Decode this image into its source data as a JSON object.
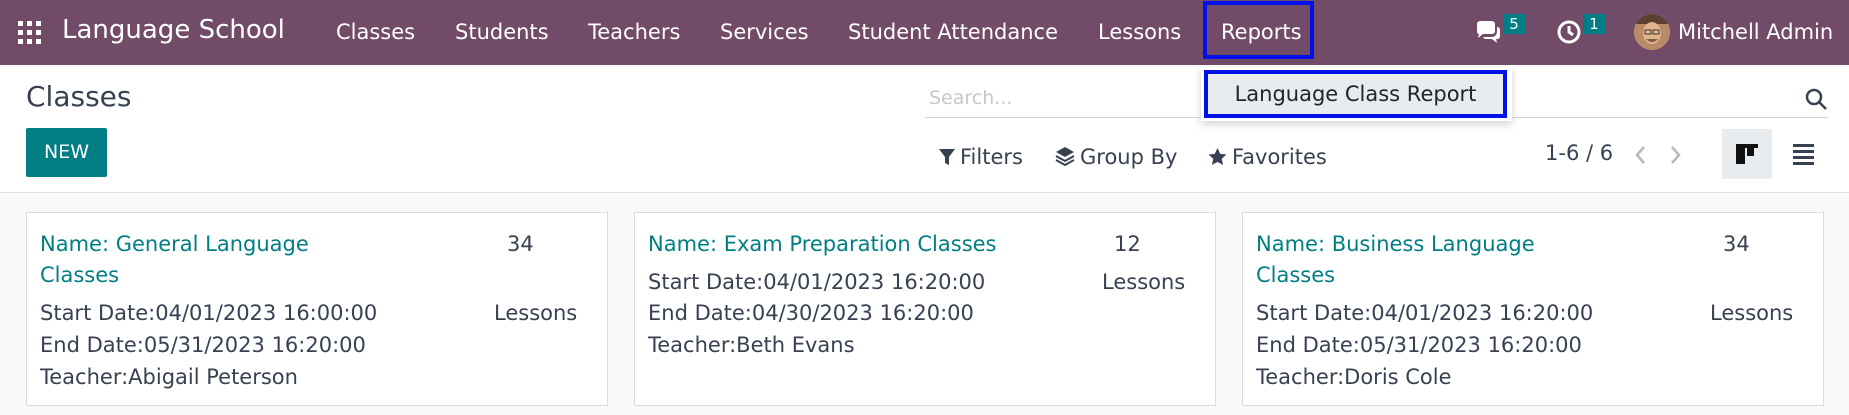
{
  "navbar": {
    "app_title": "Language School",
    "menu": [
      "Classes",
      "Students",
      "Teachers",
      "Services",
      "Student Attendance",
      "Lessons",
      "Reports"
    ],
    "messages_count": "5",
    "activities_count": "1",
    "user_name": "Mitchell Admin"
  },
  "reports_menu": {
    "items": [
      "Language Class Report"
    ]
  },
  "control_panel": {
    "title": "Classes",
    "new_label": "NEW",
    "search_placeholder": "Search...",
    "filters_label": "Filters",
    "group_by_label": "Group By",
    "favorites_label": "Favorites",
    "pager": "1-6 / 6"
  },
  "cards": [
    {
      "name": "Name: General Language Classes",
      "count": "34",
      "count_label": "Lessons",
      "start": "Start Date:04/01/2023 16:00:00",
      "end": "End Date:05/31/2023 16:20:00",
      "teacher": "Teacher:Abigail Peterson"
    },
    {
      "name": "Name: Exam Preparation Classes",
      "count": "12",
      "count_label": "Lessons",
      "start": "Start Date:04/01/2023 16:20:00",
      "end": "End Date:04/30/2023 16:20:00",
      "teacher": "Teacher:Beth Evans"
    },
    {
      "name": "Name: Business Language Classes",
      "count": "34",
      "count_label": "Lessons",
      "start": "Start Date:04/01/2023 16:20:00",
      "end": "End Date:05/31/2023 16:20:00",
      "teacher": "Teacher:Doris Cole"
    }
  ],
  "colors": {
    "navbar": "#714b67",
    "primary": "#017e84",
    "highlight_border": "#0010e6"
  }
}
